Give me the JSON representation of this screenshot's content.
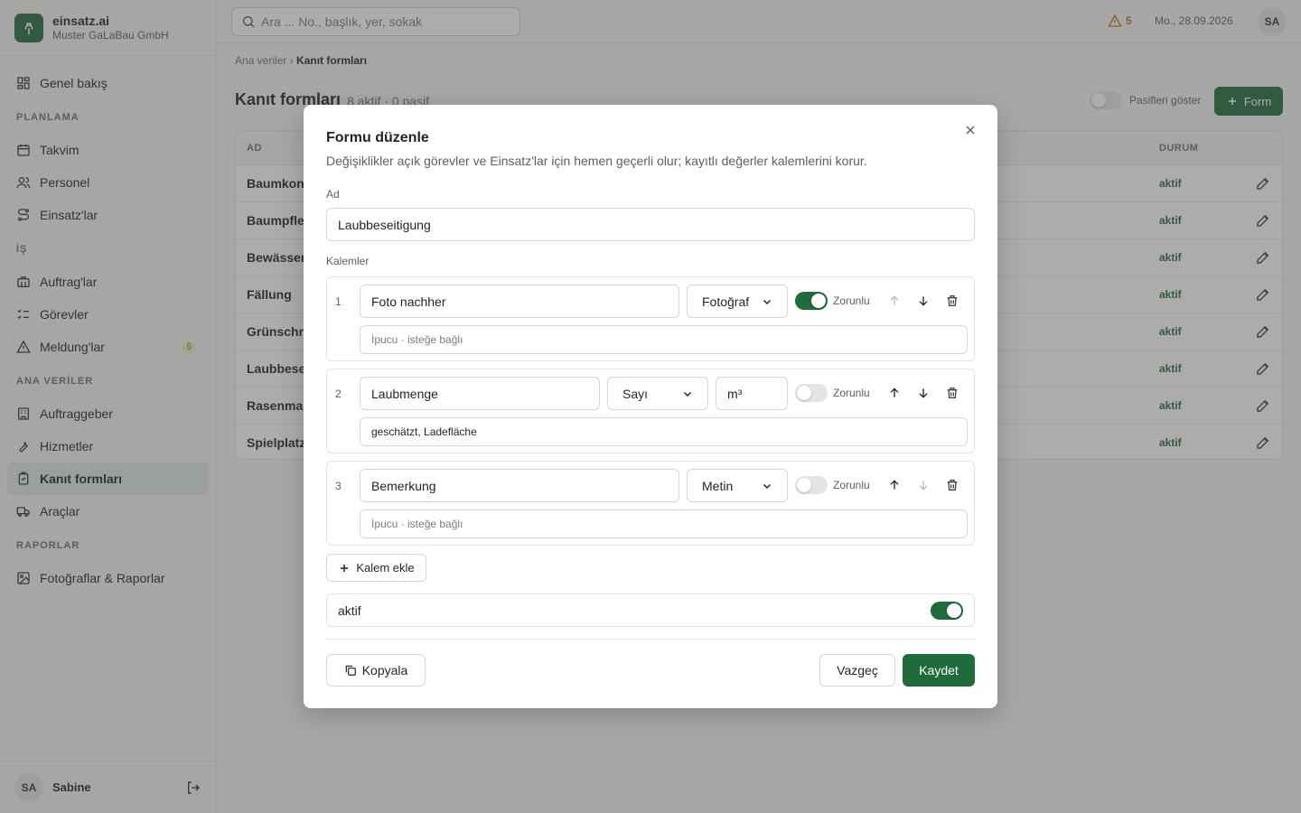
{
  "brand": {
    "name": "einsatz.ai",
    "company": "Muster GaLaBau GmbH"
  },
  "sidebar": {
    "overview": "Genel bakış",
    "sections": {
      "planning": "PLANLAMA",
      "work": "İŞ",
      "master": "ANA VERİLER",
      "reports": "RAPORLAR"
    },
    "items": [
      {
        "label": "Takvim"
      },
      {
        "label": "Personel"
      },
      {
        "label": "Einsatz'lar"
      },
      {
        "label": "Auftrag'lar"
      },
      {
        "label": "Görevler"
      },
      {
        "label": "Meldung'lar",
        "badge": "5"
      },
      {
        "label": "Auftraggeber"
      },
      {
        "label": "Hizmetler"
      },
      {
        "label": "Kanıt formları"
      },
      {
        "label": "Araçlar"
      },
      {
        "label": "Fotoğraflar & Raporlar"
      }
    ],
    "user": {
      "initials": "SA",
      "name": "Sabine"
    }
  },
  "topbar": {
    "search_placeholder": "Ara ... No., başlık, yer, sokak",
    "warnings": "5",
    "date": "Mo., 28.09.2026",
    "avatar": "SA"
  },
  "page": {
    "breadcrumb_parent": "Ana veriler",
    "breadcrumb_current": "Kanıt formları",
    "title": "Kanıt formları",
    "meta": "8 aktif · 0 pasif",
    "show_inactive": "Pasifleri göster",
    "add_form": "Form",
    "columns": {
      "name": "AD",
      "status": "DURUM"
    },
    "rows": [
      {
        "name": "Baumkont",
        "status": "aktif"
      },
      {
        "name": "Baumpfle",
        "status": "aktif"
      },
      {
        "name": "Bewässer",
        "status": "aktif"
      },
      {
        "name": "Fällung",
        "status": "aktif"
      },
      {
        "name": "Grünschn",
        "status": "aktif"
      },
      {
        "name": "Laubbese",
        "status": "aktif"
      },
      {
        "name": "Rasenmal",
        "status": "aktif"
      },
      {
        "name": "Spielplatz",
        "status": "aktif"
      }
    ]
  },
  "modal": {
    "title": "Formu düzenle",
    "description": "Değişiklikler açık görevler ve Einsatz'lar için hemen geçerli olur; kayıtlı değerler kalemlerini korur.",
    "name_label": "Ad",
    "name_value": "Laubbeseitigung",
    "items_label": "Kalemler",
    "required_label": "Zorunlu",
    "hint_placeholder": "İpucu · isteğe bağlı",
    "items": [
      {
        "index": "1",
        "name": "Foto nachher",
        "type": "Fotoğraf",
        "required": true,
        "hint": ""
      },
      {
        "index": "2",
        "name": "Laubmenge",
        "type": "Sayı",
        "unit": "m³",
        "required": false,
        "hint": "geschätzt, Ladefläche"
      },
      {
        "index": "3",
        "name": "Bemerkung",
        "type": "Metin",
        "required": false,
        "hint": ""
      }
    ],
    "add_item": "Kalem ekle",
    "active_label": "aktif",
    "active": true,
    "copy": "Kopyala",
    "cancel": "Vazgeç",
    "save": "Kaydet"
  },
  "colors": {
    "accent": "#1f6b3a",
    "warning": "#b27a10"
  }
}
